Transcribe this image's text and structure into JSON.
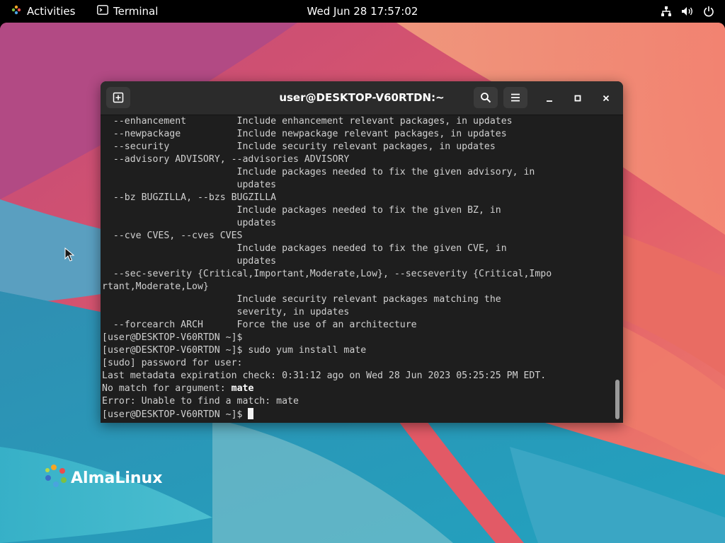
{
  "topbar": {
    "activities_label": "Activities",
    "app_label": "Terminal",
    "clock": "Wed Jun 28  17:57:02",
    "tray_icons": [
      "network-icon",
      "volume-icon",
      "power-icon"
    ]
  },
  "desktop": {
    "logo_text": "AlmaLinux"
  },
  "terminal": {
    "title": "user@DESKTOP-V60RTDN:~",
    "lines": [
      "  --enhancement         Include enhancement relevant packages, in updates",
      "  --newpackage          Include newpackage relevant packages, in updates",
      "  --security            Include security relevant packages, in updates",
      "  --advisory ADVISORY, --advisories ADVISORY",
      "                        Include packages needed to fix the given advisory, in",
      "                        updates",
      "  --bz BUGZILLA, --bzs BUGZILLA",
      "                        Include packages needed to fix the given BZ, in",
      "                        updates",
      "  --cve CVES, --cves CVES",
      "                        Include packages needed to fix the given CVE, in",
      "                        updates",
      "  --sec-severity {Critical,Important,Moderate,Low}, --secseverity {Critical,Impo",
      "rtant,Moderate,Low}",
      "                        Include security relevant packages matching the",
      "                        severity, in updates",
      "  --forcearch ARCH      Force the use of an architecture",
      "[user@DESKTOP-V60RTDN ~]$",
      "[user@DESKTOP-V60RTDN ~]$ sudo yum install mate",
      "[sudo] password for user:",
      "Last metadata expiration check: 0:31:12 ago on Wed 28 Jun 2023 05:25:25 PM EDT.",
      "No match for argument: ",
      "Error: Unable to find a match: mate",
      "[user@DESKTOP-V60RTDN ~]$ "
    ],
    "bold_arg": "mate",
    "colors": {
      "background": "#1e1e1e",
      "header": "#2b2b2b",
      "text": "#d0d0d0"
    }
  }
}
